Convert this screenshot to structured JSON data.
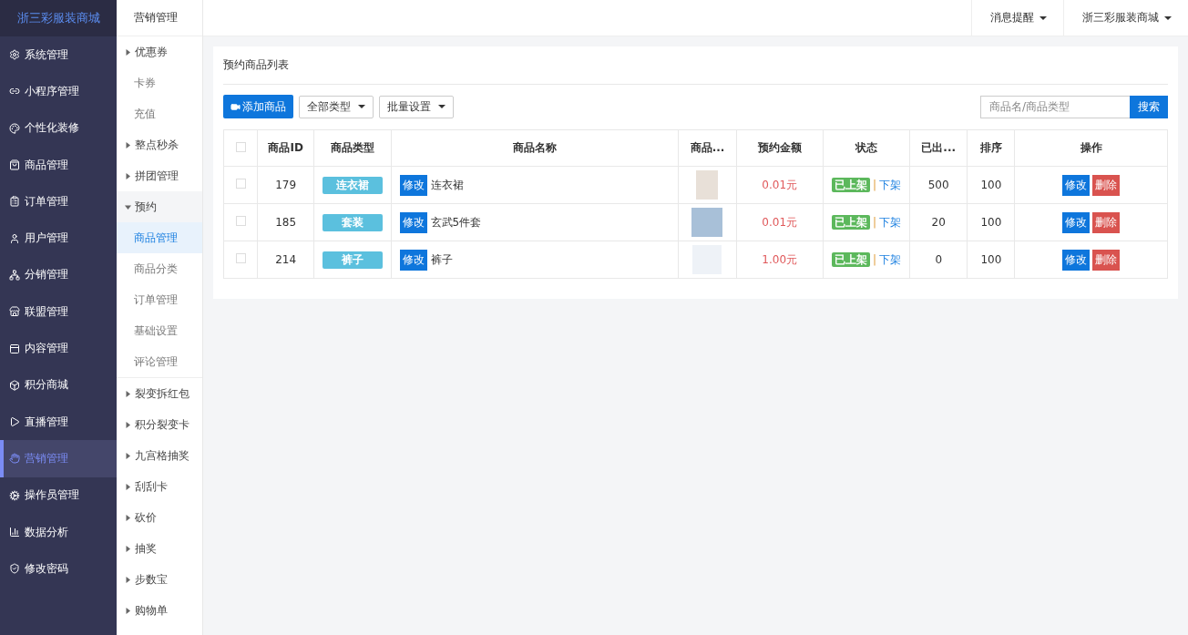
{
  "brand": "浙三彩服装商城",
  "main_menu": [
    {
      "label": "系统管理",
      "selected": false
    },
    {
      "label": "小程序管理",
      "selected": false
    },
    {
      "label": "个性化装修",
      "selected": false
    },
    {
      "label": "商品管理",
      "selected": false
    },
    {
      "label": "订单管理",
      "selected": false
    },
    {
      "label": "用户管理",
      "selected": false
    },
    {
      "label": "分销管理",
      "selected": false
    },
    {
      "label": "联盟管理",
      "selected": false
    },
    {
      "label": "内容管理",
      "selected": false
    },
    {
      "label": "积分商城",
      "selected": false
    },
    {
      "label": "直播管理",
      "selected": false
    },
    {
      "label": "营销管理",
      "selected": true
    },
    {
      "label": "操作员管理",
      "selected": false
    },
    {
      "label": "数据分析",
      "selected": false
    },
    {
      "label": "修改密码",
      "selected": false
    }
  ],
  "submenu": {
    "title": "营销管理",
    "items": [
      {
        "kind": "group",
        "label": "优惠券",
        "expanded": false
      },
      {
        "kind": "link",
        "label": "卡券"
      },
      {
        "kind": "link",
        "label": "充值"
      },
      {
        "kind": "group",
        "label": "整点秒杀",
        "expanded": false
      },
      {
        "kind": "group",
        "label": "拼团管理",
        "expanded": false
      },
      {
        "kind": "group",
        "label": "预约",
        "expanded": true,
        "children": [
          {
            "label": "商品管理",
            "selected": true
          },
          {
            "label": "商品分类",
            "selected": false
          },
          {
            "label": "订单管理",
            "selected": false
          },
          {
            "label": "基础设置",
            "selected": false
          },
          {
            "label": "评论管理",
            "selected": false
          }
        ]
      },
      {
        "kind": "group",
        "label": "裂变拆红包",
        "expanded": false
      },
      {
        "kind": "group",
        "label": "积分裂变卡",
        "expanded": false
      },
      {
        "kind": "group",
        "label": "九宫格抽奖",
        "expanded": false
      },
      {
        "kind": "group",
        "label": "刮刮卡",
        "expanded": false
      },
      {
        "kind": "group",
        "label": "砍价",
        "expanded": false
      },
      {
        "kind": "group",
        "label": "抽奖",
        "expanded": false
      },
      {
        "kind": "group",
        "label": "步数宝",
        "expanded": false
      },
      {
        "kind": "group",
        "label": "购物单",
        "expanded": false
      }
    ]
  },
  "header": {
    "notifications": "消息提醒",
    "account": "浙三彩服装商城"
  },
  "card": {
    "title": "预约商品列表",
    "toolbar": {
      "add_button": "添加商品",
      "type_filter": "全部类型",
      "batch_button": "批量设置",
      "search_placeholder": "商品名/商品类型",
      "search_button": "搜索"
    },
    "table": {
      "header_checked": false,
      "columns": [
        "商品ID",
        "商品类型",
        "商品名称",
        "商品...",
        "预约金额",
        "状态",
        "已出...",
        "排序",
        "操作"
      ],
      "rows": [
        {
          "checked": false,
          "id": "179",
          "type": "连衣裙",
          "edit": "修改",
          "name": "连衣裙",
          "amount": "0.01元",
          "status": "已上架",
          "separator": "|",
          "off_shelf": "下架",
          "sold": "500",
          "sort": "100",
          "actions": [
            "修改",
            "删除"
          ]
        },
        {
          "checked": false,
          "id": "185",
          "type": "套装",
          "edit": "修改",
          "name": "玄武5件套",
          "amount": "0.01元",
          "status": "已上架",
          "separator": "|",
          "off_shelf": "下架",
          "sold": "20",
          "sort": "100",
          "actions": [
            "修改",
            "删除"
          ]
        },
        {
          "checked": false,
          "id": "214",
          "type": "裤子",
          "edit": "修改",
          "name": "裤子",
          "amount": "1.00元",
          "status": "已上架",
          "separator": "|",
          "off_shelf": "下架",
          "sold": "0",
          "sort": "100",
          "actions": [
            "修改",
            "删除"
          ]
        }
      ]
    }
  }
}
